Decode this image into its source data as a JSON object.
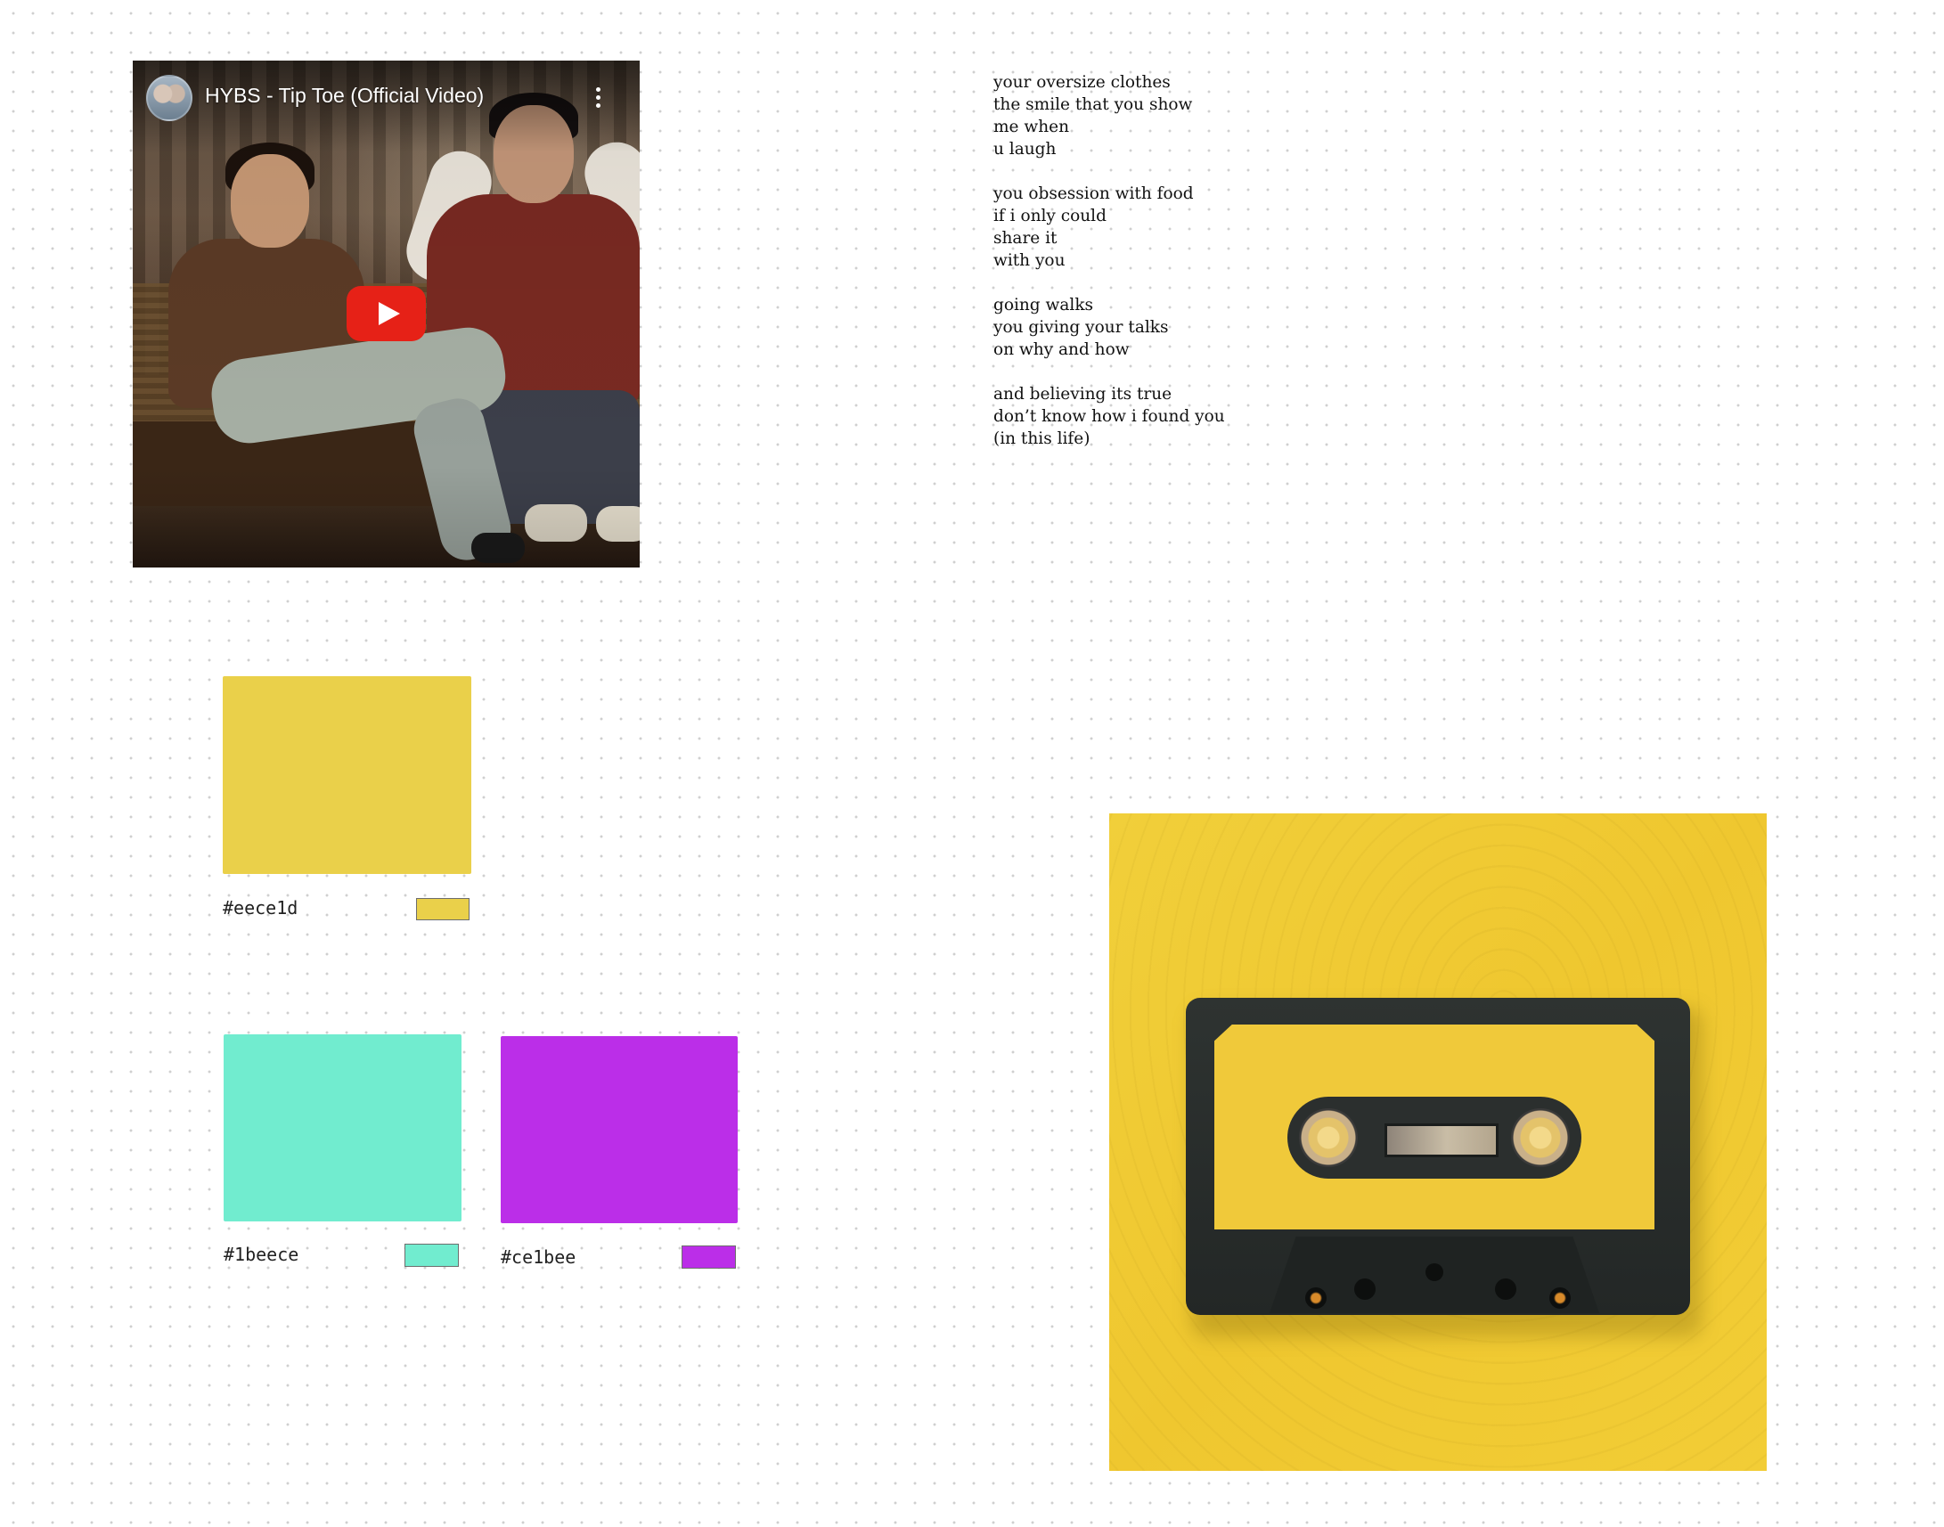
{
  "video": {
    "title": "HYBS - Tip Toe (Official Video)",
    "channel_avatar": "channel-avatar",
    "play_icon": "youtube-play-icon",
    "menu_icon": "more-vert-icon"
  },
  "poem": {
    "stanzas": [
      [
        "your oversize clothes",
        "the smile that you show",
        "me when",
        "u laugh"
      ],
      [
        "you obsession with food",
        "if i only could",
        "share it",
        "with you"
      ],
      [
        "going walks",
        "you giving your talks",
        "on why and how"
      ],
      [
        "and believing its true",
        "don’t know how i found you",
        "(in this life)"
      ]
    ]
  },
  "palette": {
    "yellow": {
      "hex_label": "#eece1d",
      "color": "#ead04a"
    },
    "teal": {
      "hex_label": "#1beece",
      "color": "#71eccf"
    },
    "purple": {
      "hex_label": "#ce1bee",
      "color": "#bb2ee8"
    }
  },
  "photo": {
    "subject": "cassette-tape",
    "background_color": "#f0cc35",
    "tape_color": "#2a2e2d"
  }
}
